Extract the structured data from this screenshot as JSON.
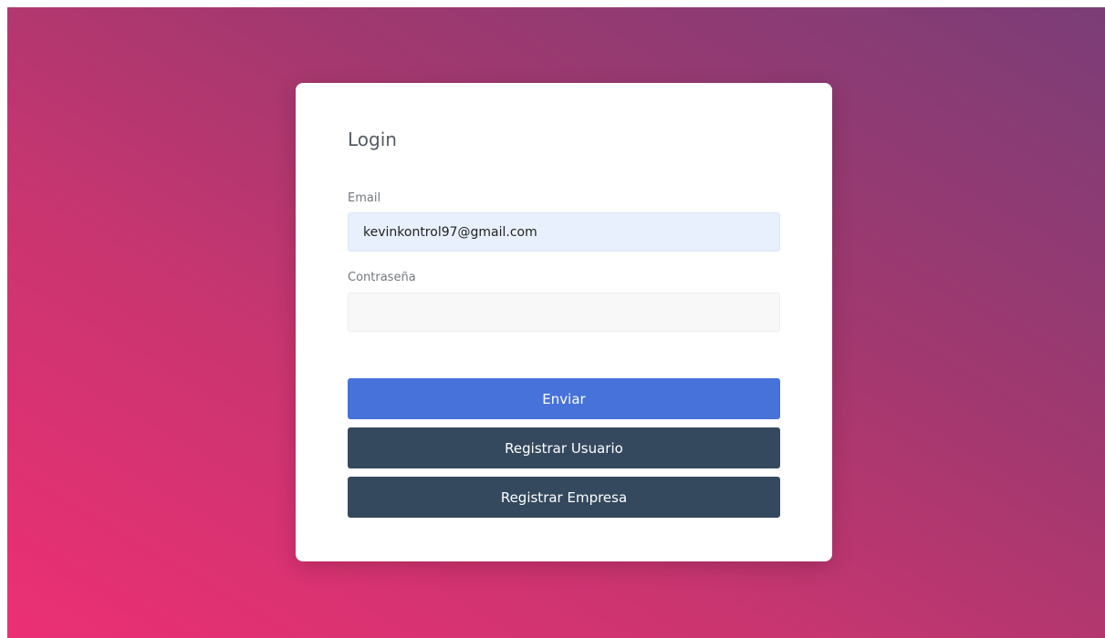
{
  "login": {
    "title": "Login",
    "email": {
      "label": "Email",
      "value": "kevinkontrol97@gmail.com",
      "placeholder": ""
    },
    "password": {
      "label": "Contraseña",
      "value": "",
      "placeholder": ""
    },
    "buttons": {
      "send": "Enviar",
      "register_user": "Registrar Usuario",
      "register_company": "Registrar Empresa"
    }
  },
  "colors": {
    "gradient_start": "#ec2f74",
    "gradient_end": "#7b3d77",
    "primary_button": "#4672d9",
    "secondary_button": "#34495e",
    "email_field_bg": "#e8f0fd"
  }
}
